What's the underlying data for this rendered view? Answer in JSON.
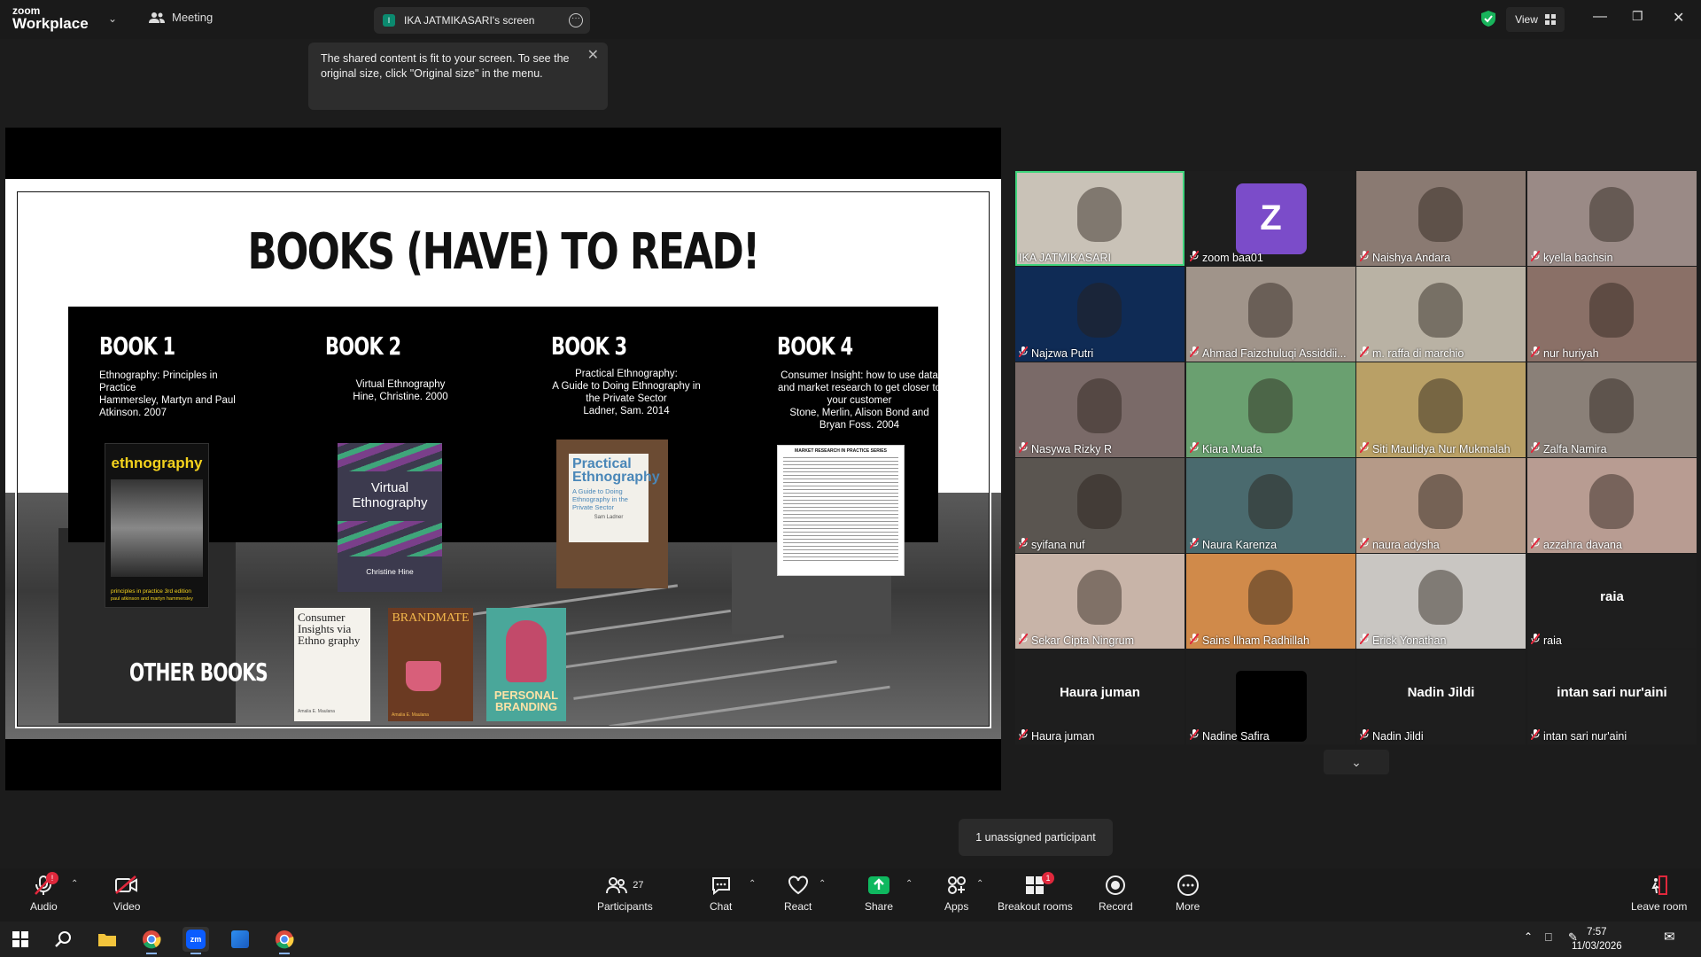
{
  "app": {
    "logo_line1": "zoom",
    "logo_line2": "Workplace",
    "meeting_label": "Meeting",
    "screen_tab_label": "IKA JATMIKASARI's screen",
    "screen_tab_initial": "I",
    "view_label": "View"
  },
  "tooltip": {
    "text": "The shared content is fit to your screen. To see the original size, click \"Original size\" in the menu."
  },
  "slide": {
    "title": "BOOKS (HAVE) TO READ!",
    "books": [
      {
        "heading": "BOOK 1",
        "desc": "Ethnography: Principles in Practice\nHammersley, Martyn and Paul Atkinson. 2007",
        "cover_title": "ethnography",
        "cover_sub": "principles in practice 3rd edition",
        "cover_author": "paul atkinson and martyn hammersley"
      },
      {
        "heading": "BOOK 2",
        "desc": "Virtual Ethnography\nHine, Christine. 2000",
        "cover_title": "Virtual Ethnography",
        "cover_author": "Christine Hine"
      },
      {
        "heading": "BOOK 3",
        "desc": "Practical Ethnography:\nA Guide to Doing Ethnography in the Private Sector\nLadner, Sam. 2014",
        "cover_title": "Practical Ethnography",
        "cover_sub": "A Guide to Doing Ethnography in the Private Sector",
        "cover_author": "Sam Ladner"
      },
      {
        "heading": "BOOK 4",
        "desc": "Consumer Insight: how to use data and market research to get closer to your customer\nStone, Merlin, Alison Bond and Bryan Foss. 2004",
        "cover_title": "MARKET RESEARCH IN PRACTICE SERIES"
      }
    ],
    "other_books_label": "OTHER BOOKS",
    "other_covers": [
      {
        "title": "Consumer Insights via Ethno graphy",
        "author": "Amalia E. Maulana"
      },
      {
        "title": "BRANDMATE",
        "author": "Amalia E. Maulana"
      },
      {
        "title": "PERSONAL BRANDING",
        "author": ""
      }
    ]
  },
  "participants": [
    {
      "name": "IKA JATMIKASARI",
      "muted": false,
      "active": true
    },
    {
      "name": "zoom baa01",
      "muted": true,
      "avatar": "Z"
    },
    {
      "name": "Naishya Andara",
      "muted": true
    },
    {
      "name": "kyella bachsin",
      "muted": true
    },
    {
      "name": "Najzwa Putri",
      "muted": true
    },
    {
      "name": "Ahmad Faizchuluqi Assiddii...",
      "muted": true
    },
    {
      "name": "m. raffa di marchio",
      "muted": true
    },
    {
      "name": "nur huriyah",
      "muted": true
    },
    {
      "name": "Nasywa Rizky R",
      "muted": true
    },
    {
      "name": "Kiara Muafa",
      "muted": true
    },
    {
      "name": "Siti Maulidya Nur Mukmalah",
      "muted": true
    },
    {
      "name": "Zalfa Namira",
      "muted": true
    },
    {
      "name": "syifana nuf",
      "muted": true
    },
    {
      "name": "Naura Karenza",
      "muted": true
    },
    {
      "name": "naura adysha",
      "muted": true
    },
    {
      "name": "azzahra davana",
      "muted": true
    },
    {
      "name": "Sekar Cipta Ningrum",
      "muted": true
    },
    {
      "name": "Sains Ilham Radhillah",
      "muted": true
    },
    {
      "name": "Erick Yonathan",
      "muted": true
    },
    {
      "name": "raia",
      "muted": true,
      "center": "raia"
    },
    {
      "name": "Haura juman",
      "muted": true,
      "center": "Haura juman"
    },
    {
      "name": "Nadine Safira",
      "muted": true
    },
    {
      "name": "Nadin Jildi",
      "muted": true,
      "center": "Nadin Jildi"
    },
    {
      "name": "intan sari nur'aini",
      "muted": true,
      "center": "intan sari nur'aini"
    }
  ],
  "unassigned": "1 unassigned participant",
  "toolbar": {
    "audio": "Audio",
    "video": "Video",
    "participants": "Participants",
    "participants_count": "27",
    "chat": "Chat",
    "react": "React",
    "share": "Share",
    "apps": "Apps",
    "breakout": "Breakout rooms",
    "breakout_badge": "1",
    "record": "Record",
    "more": "More",
    "leave": "Leave room"
  },
  "taskbar": {
    "time": "7:57",
    "date": "11/03/2026"
  },
  "colors": {
    "active_speaker": "#3fd47c",
    "share_green": "#0fb85f",
    "badge_red": "#e0283c",
    "avatar_purple": "#7b4cc9"
  }
}
